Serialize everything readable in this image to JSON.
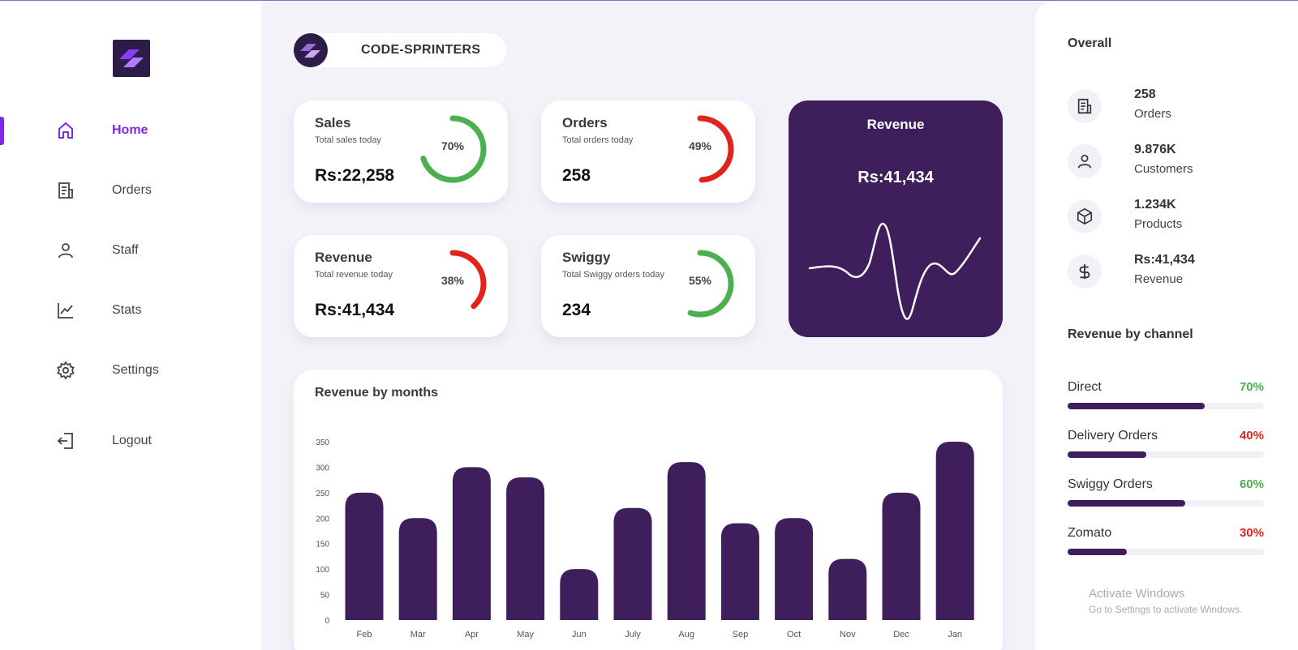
{
  "brand": {
    "name": "CODE-SPRINTERS"
  },
  "colors": {
    "accent": "#7c2ae8",
    "dark_purple": "#3e1f5c",
    "green": "#4caf50",
    "red": "#e0241b"
  },
  "sidebar": {
    "items": [
      {
        "label": "Home",
        "icon": "home-icon",
        "active": true
      },
      {
        "label": "Orders",
        "icon": "orders-icon"
      },
      {
        "label": "Staff",
        "icon": "user-icon"
      },
      {
        "label": "Stats",
        "icon": "chart-line-icon"
      },
      {
        "label": "Settings",
        "icon": "gear-icon"
      },
      {
        "label": "Logout",
        "icon": "logout-icon"
      }
    ]
  },
  "cards": [
    {
      "title": "Sales",
      "subtitle": "Total sales today",
      "value": "Rs:22,258",
      "percent": "70%",
      "fraction": 0.7,
      "color": "#4caf50"
    },
    {
      "title": "Orders",
      "subtitle": "Total orders today",
      "value": "258",
      "percent": "49%",
      "fraction": 0.49,
      "color": "#e0241b"
    },
    {
      "title": "Revenue",
      "subtitle": "Total revenue today",
      "value": "Rs:41,434",
      "percent": "38%",
      "fraction": 0.38,
      "color": "#e0241b"
    },
    {
      "title": "Swiggy",
      "subtitle": "Total Swiggy orders today",
      "value": "234",
      "percent": "55%",
      "fraction": 0.55,
      "color": "#4caf50"
    }
  ],
  "revenue_card": {
    "title": "Revenue",
    "value": "Rs:41,434"
  },
  "chart_data": {
    "type": "bar",
    "title": "Revenue by months",
    "categories": [
      "Feb",
      "Mar",
      "Apr",
      "May",
      "Jun",
      "July",
      "Aug",
      "Sep",
      "Oct",
      "Nov",
      "Dec",
      "Jan"
    ],
    "values": [
      250,
      200,
      300,
      280,
      100,
      220,
      310,
      190,
      200,
      120,
      250,
      350
    ],
    "yticks": [
      0,
      50,
      100,
      150,
      200,
      250,
      300,
      350
    ],
    "ylim": [
      0,
      350
    ],
    "color": "#3e1f5c"
  },
  "overall": {
    "title": "Overall",
    "items": [
      {
        "value": "258",
        "label": "Orders",
        "icon": "orders-icon"
      },
      {
        "value": "9.876K",
        "label": "Customers",
        "icon": "user-icon"
      },
      {
        "value": "1.234K",
        "label": "Products",
        "icon": "box-icon"
      },
      {
        "value": "Rs:41,434",
        "label": "Revenue",
        "icon": "dollar-icon"
      }
    ]
  },
  "channels": {
    "title": "Revenue by channel",
    "items": [
      {
        "name": "Direct",
        "percent": "70%",
        "fraction": 0.7,
        "color": "#4caf50"
      },
      {
        "name": "Delivery Orders",
        "percent": "40%",
        "fraction": 0.4,
        "color": "#e0241b"
      },
      {
        "name": "Swiggy Orders",
        "percent": "60%",
        "fraction": 0.6,
        "color": "#4caf50"
      },
      {
        "name": "Zomato",
        "percent": "30%",
        "fraction": 0.3,
        "color": "#e0241b"
      }
    ]
  },
  "watermark": {
    "line1": "Activate Windows",
    "line2": "Go to Settings to activate Windows."
  }
}
